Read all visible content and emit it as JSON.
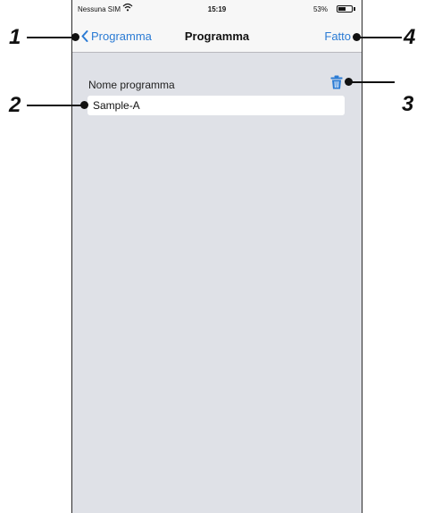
{
  "status_bar": {
    "carrier": "Nessuna SIM",
    "time": "15:19",
    "battery": "53%"
  },
  "nav": {
    "back_label": "Programma",
    "title": "Programma",
    "done_label": "Fatto"
  },
  "form": {
    "field_label": "Nome programma",
    "field_value": "Sample-A"
  },
  "callouts": [
    "1",
    "2",
    "3",
    "4"
  ],
  "colors": {
    "accent": "#2b7bd4",
    "background": "#dfe1e7",
    "bar": "#f7f7f7"
  },
  "icons": [
    "wifi-icon",
    "battery-icon",
    "chevron-left-icon",
    "trash-icon"
  ]
}
